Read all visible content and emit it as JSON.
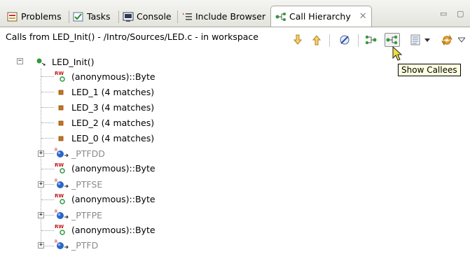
{
  "tabs": [
    {
      "label": "Problems",
      "icon": "problems-icon"
    },
    {
      "label": "Tasks",
      "icon": "tasks-icon"
    },
    {
      "label": "Console",
      "icon": "console-icon"
    },
    {
      "label": "Include Browser",
      "icon": "include-browser-icon"
    },
    {
      "label": "Call Hierarchy",
      "icon": "call-hierarchy-icon",
      "active": true
    }
  ],
  "toolbar": {
    "breadcrumb": "Calls from LED_Init() - /Intro/Sources/LED.c - in workspace",
    "tooltip": "Show Callees"
  },
  "tree": {
    "root": {
      "label": "LED_Init()"
    },
    "items": [
      {
        "label": "(anonymous)::Byte",
        "kind": "rw-variable"
      },
      {
        "label": "LED_1 (4 matches)",
        "kind": "macro"
      },
      {
        "label": "LED_3 (4 matches)",
        "kind": "macro"
      },
      {
        "label": "LED_2 (4 matches)",
        "kind": "macro"
      },
      {
        "label": "LED_0 (4 matches)",
        "kind": "macro"
      },
      {
        "label": "_PTFDD",
        "kind": "variable-collapsed"
      },
      {
        "label": "(anonymous)::Byte",
        "kind": "rw-variable"
      },
      {
        "label": "_PTFSE",
        "kind": "variable-collapsed"
      },
      {
        "label": "(anonymous)::Byte",
        "kind": "rw-variable"
      },
      {
        "label": "_PTFPE",
        "kind": "variable-collapsed"
      },
      {
        "label": "(anonymous)::Byte",
        "kind": "rw-variable"
      },
      {
        "label": "_PTFD",
        "kind": "variable-collapsed"
      }
    ]
  },
  "colors": {
    "accent_green": "#2e9a3a",
    "macro_orange": "#c8741c",
    "variable_blue": "#2a68c8",
    "rw_red": "#c01818",
    "tooltip_bg": "#ffffe1"
  }
}
